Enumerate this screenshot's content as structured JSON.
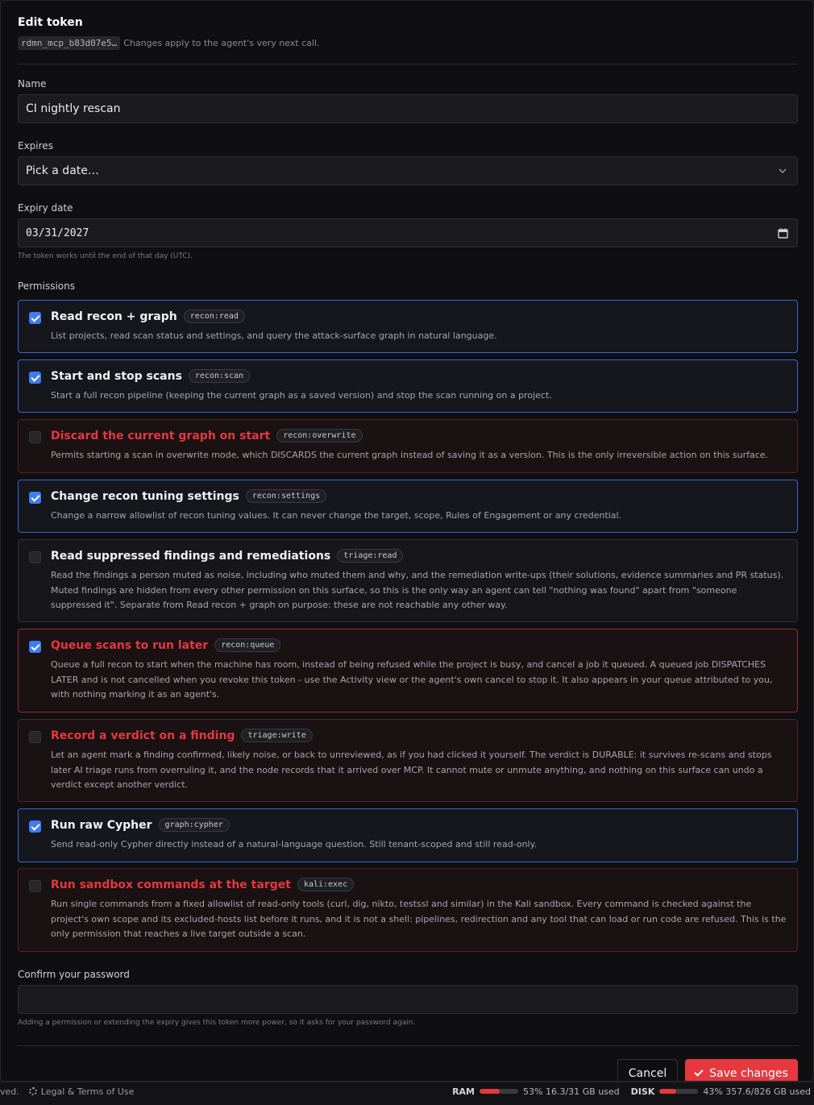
{
  "dialog": {
    "title": "Edit token",
    "token_id": "rdmn_mcp_b83d07e5…",
    "subtitle": "Changes apply to the agent's very next call."
  },
  "form": {
    "name_label": "Name",
    "name_value": "CI nightly rescan",
    "expires_label": "Expires",
    "expires_value": "Pick a date…",
    "expiry_date_label": "Expiry date",
    "expiry_date_value": "03/31/2027",
    "expiry_hint": "The token works until the end of that day (UTC).",
    "permissions_label": "Permissions",
    "password_label": "Confirm your password",
    "password_value": "",
    "password_hint": "Adding a permission or extending the expiry gives this token more power, so it asks for your password again."
  },
  "permissions": [
    {
      "name": "Read recon + graph",
      "scope": "recon:read",
      "checked": true,
      "danger": false,
      "desc": "List projects, read scan status and settings, and query the attack-surface graph in natural language."
    },
    {
      "name": "Start and stop scans",
      "scope": "recon:scan",
      "checked": true,
      "danger": false,
      "desc": "Start a full recon pipeline (keeping the current graph as a saved version) and stop the scan running on a project."
    },
    {
      "name": "Discard the current graph on start",
      "scope": "recon:overwrite",
      "checked": false,
      "danger": true,
      "desc": "Permits starting a scan in overwrite mode, which DISCARDS the current graph instead of saving it as a version. This is the only irreversible action on this surface."
    },
    {
      "name": "Change recon tuning settings",
      "scope": "recon:settings",
      "checked": true,
      "danger": false,
      "desc": "Change a narrow allowlist of recon tuning values. It can never change the target, scope, Rules of Engagement or any credential."
    },
    {
      "name": "Read suppressed findings and remediations",
      "scope": "triage:read",
      "checked": false,
      "danger": false,
      "desc": "Read the findings a person muted as noise, including who muted them and why, and the remediation write-ups (their solutions, evidence summaries and PR status). Muted findings are hidden from every other permission on this surface, so this is the only way an agent can tell \"nothing was found\" apart from \"someone suppressed it\". Separate from Read recon + graph on purpose: these are not reachable any other way."
    },
    {
      "name": "Queue scans to run later",
      "scope": "recon:queue",
      "checked": true,
      "danger": true,
      "desc": "Queue a full recon to start when the machine has room, instead of being refused while the project is busy, and cancel a job it queued. A queued job DISPATCHES LATER and is not cancelled when you revoke this token - use the Activity view or the agent's own cancel to stop it. It also appears in your queue attributed to you, with nothing marking it as an agent's."
    },
    {
      "name": "Record a verdict on a finding",
      "scope": "triage:write",
      "checked": false,
      "danger": true,
      "desc": "Let an agent mark a finding confirmed, likely noise, or back to unreviewed, as if you had clicked it yourself. The verdict is DURABLE: it survives re-scans and stops later AI triage runs from overruling it, and the node records that it arrived over MCP. It cannot mute or unmute anything, and nothing on this surface can undo a verdict except another verdict."
    },
    {
      "name": "Run raw Cypher",
      "scope": "graph:cypher",
      "checked": true,
      "danger": false,
      "desc": "Send read-only Cypher directly instead of a natural-language question. Still tenant-scoped and still read-only."
    },
    {
      "name": "Run sandbox commands at the target",
      "scope": "kali:exec",
      "checked": false,
      "danger": true,
      "desc": "Run single commands from a fixed allowlist of read-only tools (curl, dig, nikto, testssl and similar) in the Kali sandbox. Every command is checked against the project's own scope and its excluded-hosts list before it runs, and it is not a shell: pipelines, redirection and any tool that can load or run code are refused. This is the only permission that reaches a live target outside a scan."
    }
  ],
  "buttons": {
    "cancel": "Cancel",
    "save": "Save changes"
  },
  "statusbar": {
    "left_fragment": "ved.",
    "legal": "Legal & Terms of Use",
    "ram_label": "RAM",
    "ram_percent": 53,
    "ram_text": "53% 16.3/31 GB used",
    "disk_label": "DISK",
    "disk_percent": 43,
    "disk_text": "43% 357.6/826 GB used",
    "accent_color": "#e5383f"
  }
}
